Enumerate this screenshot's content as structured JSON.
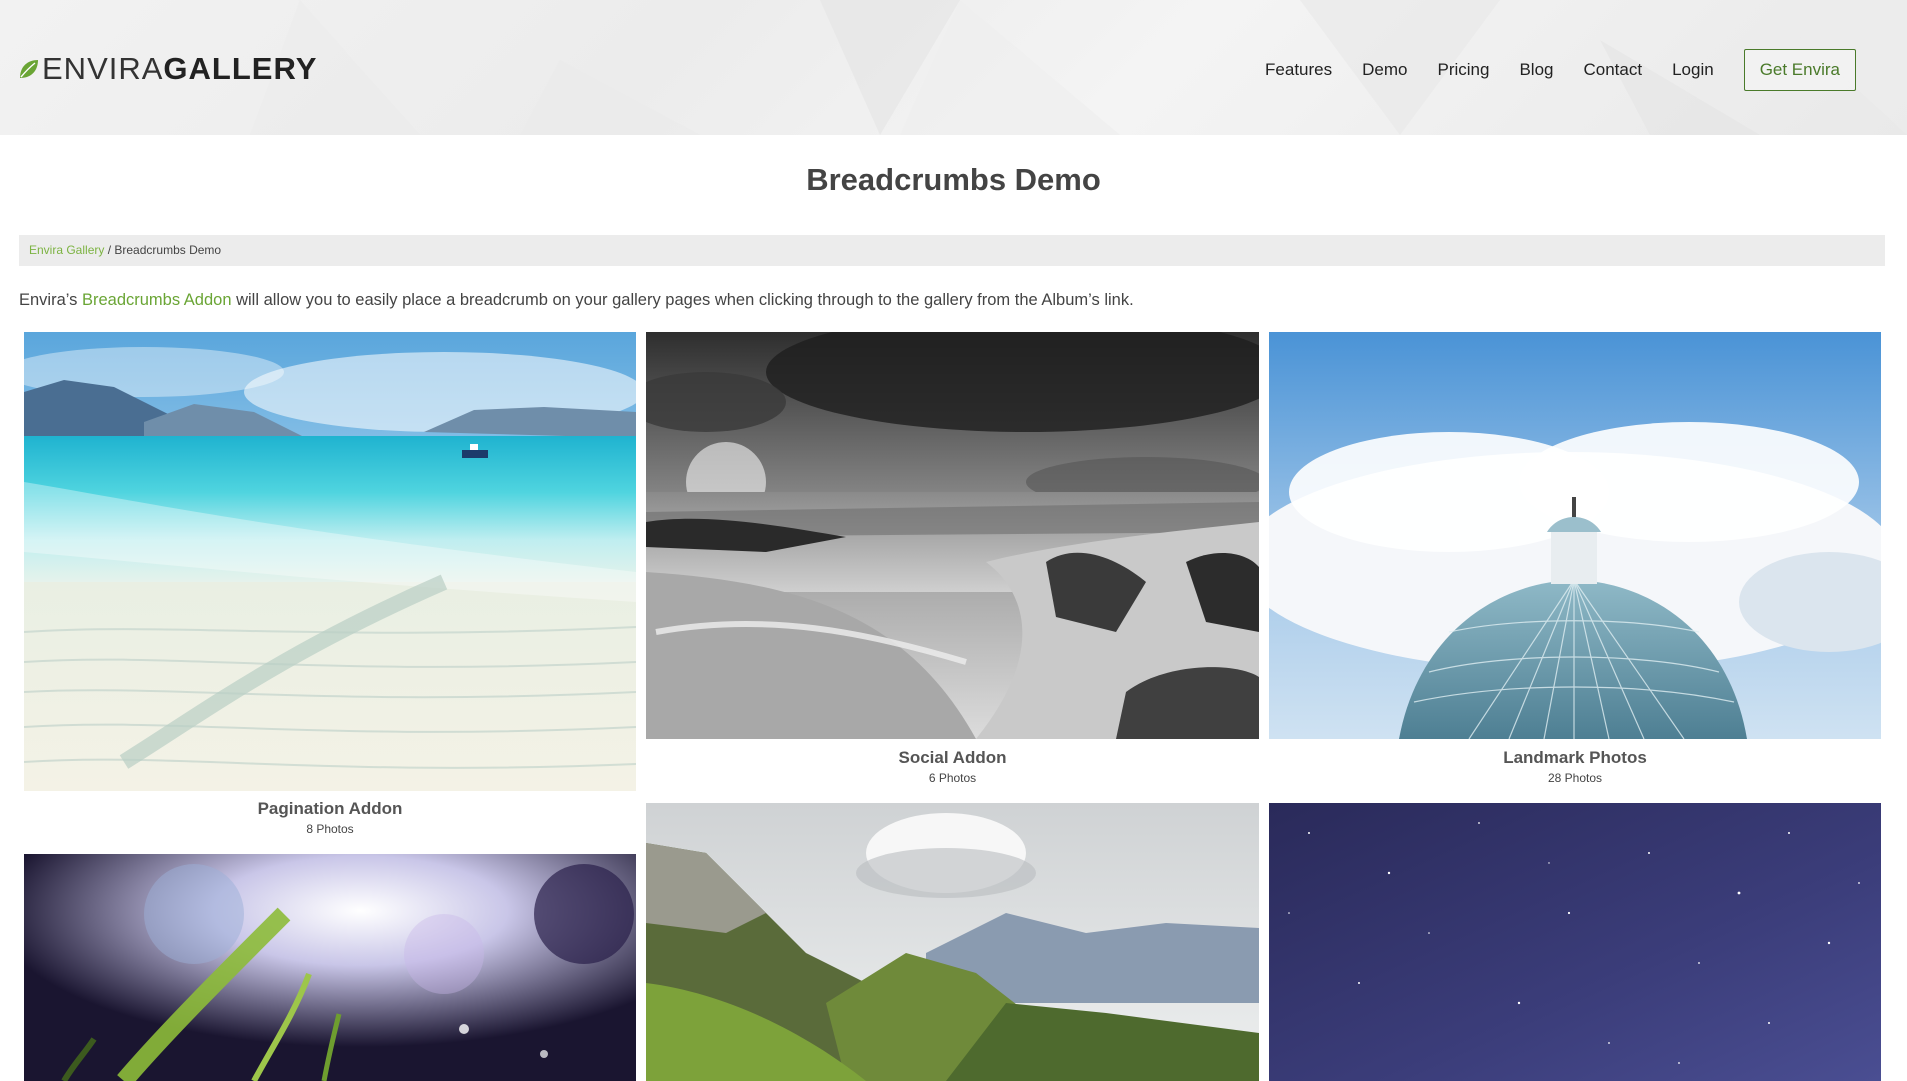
{
  "header": {
    "logo": {
      "light": "ENVIRA",
      "bold": "GALLERY"
    },
    "nav": [
      "Features",
      "Demo",
      "Pricing",
      "Blog",
      "Contact",
      "Login"
    ],
    "cta": "Get Envira"
  },
  "page": {
    "title": "Breadcrumbs Demo"
  },
  "breadcrumb": {
    "home": "Envira Gallery",
    "separator": " / ",
    "current": "Breadcrumbs Demo"
  },
  "intro": {
    "prefix": "Envira’s ",
    "link": "Breadcrumbs Addon",
    "suffix": " will allow you to easily place a breadcrumb on your gallery pages when clicking through to the gallery from the Album’s link."
  },
  "gallery": [
    {
      "title": "Pagination Addon",
      "count": "8 Photos",
      "image": "tropical-beach-photo"
    },
    {
      "title": "Social Addon",
      "count": "6 Photos",
      "image": "black-and-white-seashore-photo"
    },
    {
      "title": "Landmark Photos",
      "count": "28 Photos",
      "image": "glass-dome-building-photo"
    },
    {
      "title": "",
      "count": "",
      "image": "sunlit-grass-closeup-photo"
    },
    {
      "title": "",
      "count": "",
      "image": "mountain-valley-photo"
    },
    {
      "title": "",
      "count": "",
      "image": "starry-night-sky-photo"
    }
  ],
  "colors": {
    "accent": "#7cb342",
    "cta_border": "#4a7a2a",
    "breadcrumb_bg": "#ececec",
    "text": "#444444"
  }
}
